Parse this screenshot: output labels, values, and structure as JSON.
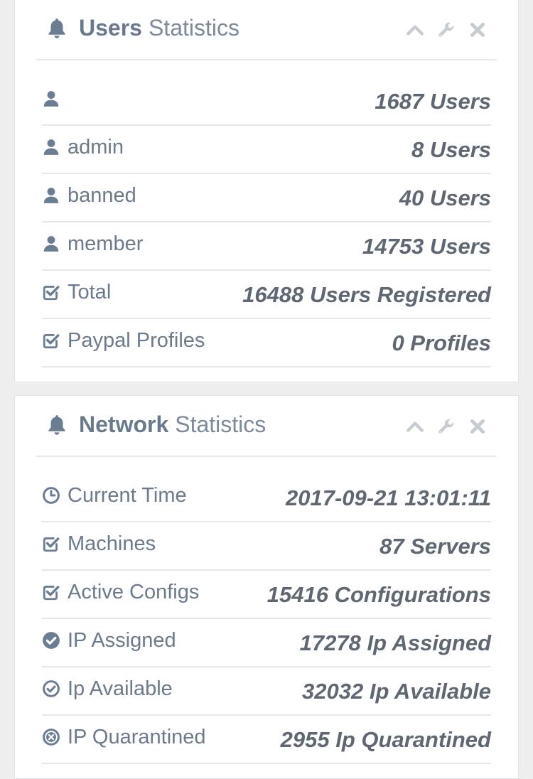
{
  "users_widget": {
    "title_strong": "Users",
    "title_light": "Statistics",
    "rows": [
      {
        "icon": "user-icon",
        "label": "",
        "value": "1687 Users"
      },
      {
        "icon": "user-icon",
        "label": "admin",
        "value": "8 Users"
      },
      {
        "icon": "user-icon",
        "label": "banned",
        "value": "40 Users"
      },
      {
        "icon": "user-icon",
        "label": "member",
        "value": "14753 Users"
      },
      {
        "icon": "check-square-icon",
        "label": "Total",
        "value": "16488 Users Registered"
      },
      {
        "icon": "check-square-icon",
        "label": "Paypal Profiles",
        "value": "0 Profiles"
      }
    ]
  },
  "network_widget": {
    "title_strong": "Network",
    "title_light": "Statistics",
    "rows": [
      {
        "icon": "clock-icon",
        "label": "Current Time",
        "value": "2017-09-21 13:01:11"
      },
      {
        "icon": "check-square-icon",
        "label": "Machines",
        "value": "87 Servers"
      },
      {
        "icon": "check-square-icon",
        "label": "Active Configs",
        "value": "15416 Configurations"
      },
      {
        "icon": "check-circle-icon",
        "label": "IP Assigned",
        "value": "17278 Ip Assigned"
      },
      {
        "icon": "check-circle-outline-icon",
        "label": "Ip Available",
        "value": "32032 Ip Available"
      },
      {
        "icon": "times-circle-icon",
        "label": "IP Quarantined",
        "value": "2955 Ip Quarantined"
      }
    ]
  },
  "toolbar_icons": [
    "chevron-up-icon",
    "wrench-icon",
    "close-icon"
  ],
  "colors": {
    "icon": "#6b7d92",
    "toolbar_icon": "#c7ccd2",
    "value_text": "#5f6773",
    "label_text": "#6c7a8d",
    "divider": "#e4e8ec"
  }
}
